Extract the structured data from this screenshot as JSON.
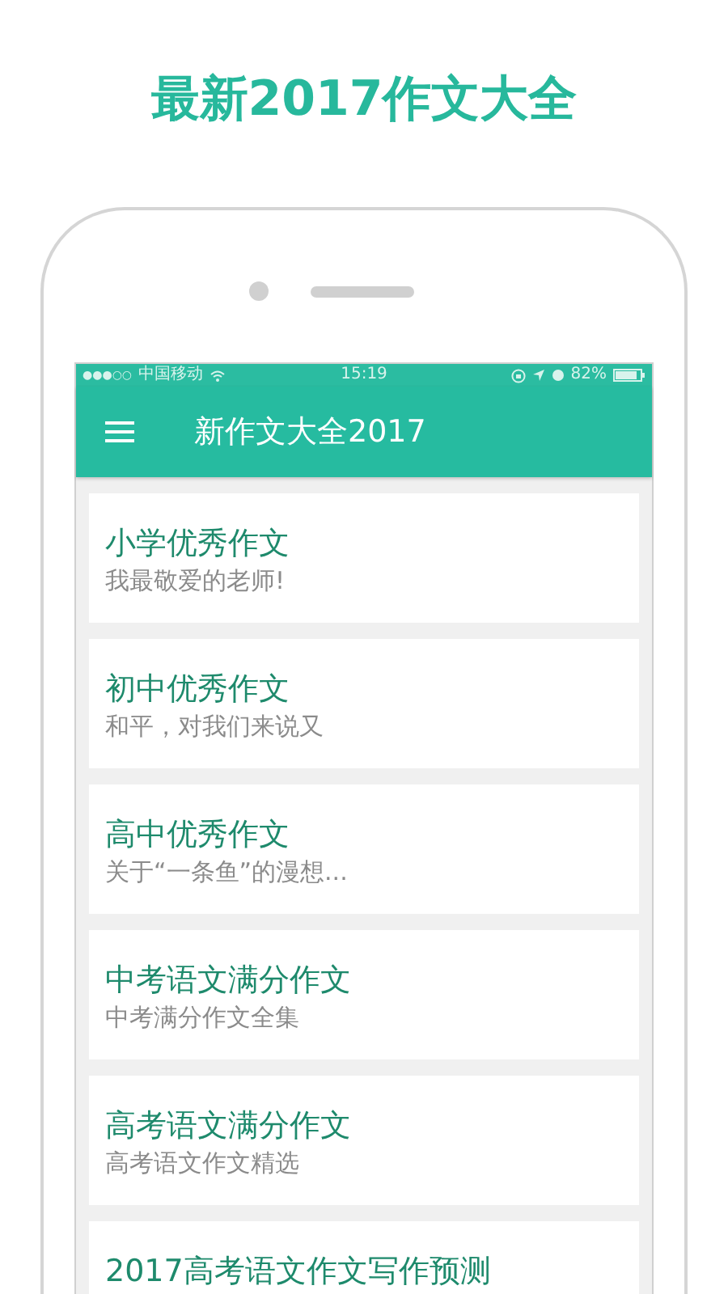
{
  "headline": "最新2017作文大全",
  "status_bar": {
    "signal": "●●●○○",
    "carrier": "中国移动",
    "time": "15:19",
    "battery": "82%"
  },
  "app_bar": {
    "title": "新作文大全2017"
  },
  "articles": [
    {
      "title": "小学优秀作文",
      "subtitle": "我最敬爱的老师!"
    },
    {
      "title": "初中优秀作文",
      "subtitle": "和平，对我们来说又"
    },
    {
      "title": "高中优秀作文",
      "subtitle": "关于“一条鱼”的漫想..."
    },
    {
      "title": "中考语文满分作文",
      "subtitle": "中考满分作文全集"
    },
    {
      "title": "高考语文满分作文",
      "subtitle": "高考语文作文精选"
    },
    {
      "title": "2017高考语文作文写作预测"
    }
  ]
}
